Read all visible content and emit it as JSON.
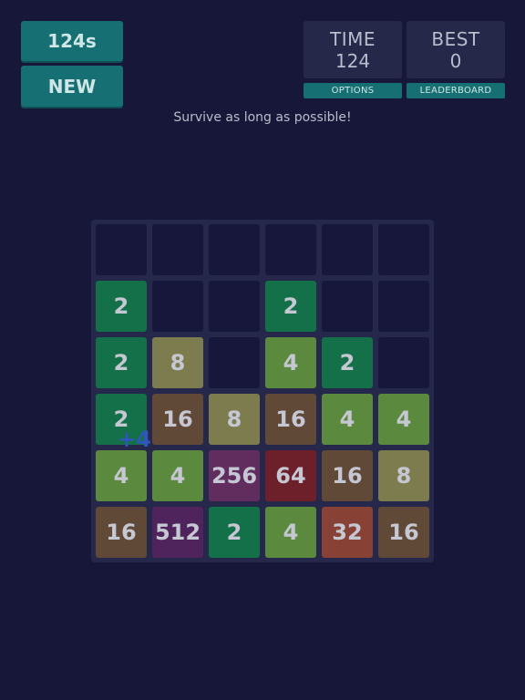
{
  "header": {
    "timer_label": "124s",
    "new_label": "NEW",
    "time": {
      "label": "TIME",
      "value": "124"
    },
    "best": {
      "label": "BEST",
      "value": "0"
    },
    "options_label": "OPTIONS",
    "leaderboard_label": "LEADERBOARD"
  },
  "subtitle": "Survive as long as possible!",
  "bonus_text": "+4",
  "colors": {
    "background": "#17173a",
    "board": "#25284a",
    "empty_cell": "#16173a",
    "teal_button": "#166f72",
    "tile_2": "#147049",
    "tile_4": "#5b8a3f",
    "tile_8": "#7c7c4e",
    "tile_16": "#614938",
    "tile_32": "#874235",
    "tile_64": "#6d1f2a",
    "tile_256": "#612d5f",
    "tile_512": "#4f235c"
  },
  "board": {
    "rows": 6,
    "cols": 6,
    "grid": [
      [
        0,
        0,
        0,
        0,
        0,
        0
      ],
      [
        2,
        0,
        0,
        2,
        0,
        0
      ],
      [
        2,
        8,
        0,
        4,
        2,
        0
      ],
      [
        2,
        16,
        8,
        16,
        4,
        4
      ],
      [
        4,
        4,
        256,
        64,
        16,
        8
      ],
      [
        16,
        512,
        2,
        4,
        32,
        16
      ]
    ]
  }
}
